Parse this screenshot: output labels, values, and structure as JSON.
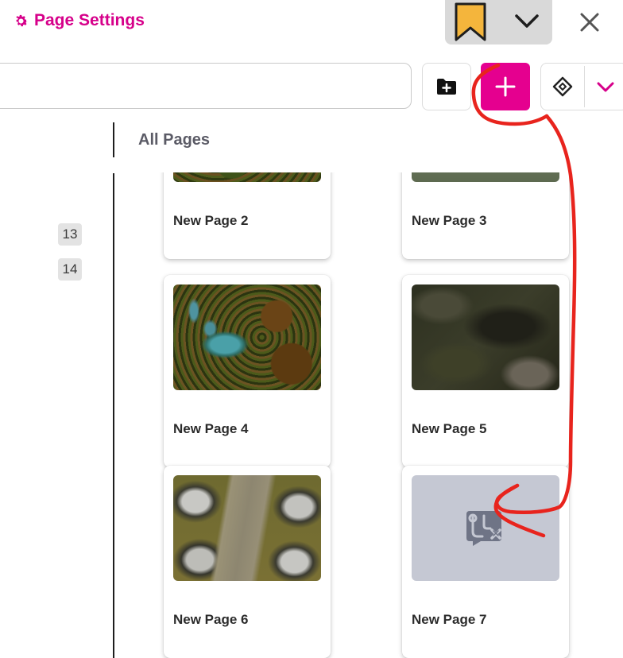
{
  "header": {
    "title": "Page Settings"
  },
  "toolbar": {
    "search_placeholder": "",
    "folder_button": "add-folder",
    "add_button": "add-page",
    "sort_button": "sort-options"
  },
  "sidebar": {
    "heading": "All Pages",
    "numbers": [
      "13",
      "14"
    ]
  },
  "pages": [
    {
      "title": "New Page 2",
      "thumb": "forest"
    },
    {
      "title": "New Page 3",
      "thumb": "grass-road"
    },
    {
      "title": "New Page 4",
      "thumb": "swamp"
    },
    {
      "title": "New Page 5",
      "thumb": "cave"
    },
    {
      "title": "New Page 6",
      "thumb": "rocky-path"
    },
    {
      "title": "New Page 7",
      "thumb": "no-map-placeholder"
    }
  ],
  "colors": {
    "accent": "#e5008f",
    "bookmark": "#f4b53c",
    "annotation": "#e8241d"
  },
  "icons": [
    "gear-icon",
    "bookmark-icon",
    "chevron-down-icon",
    "close-icon",
    "folder-plus-icon",
    "plus-icon",
    "sort-diamond-icon",
    "no-map-icon"
  ]
}
